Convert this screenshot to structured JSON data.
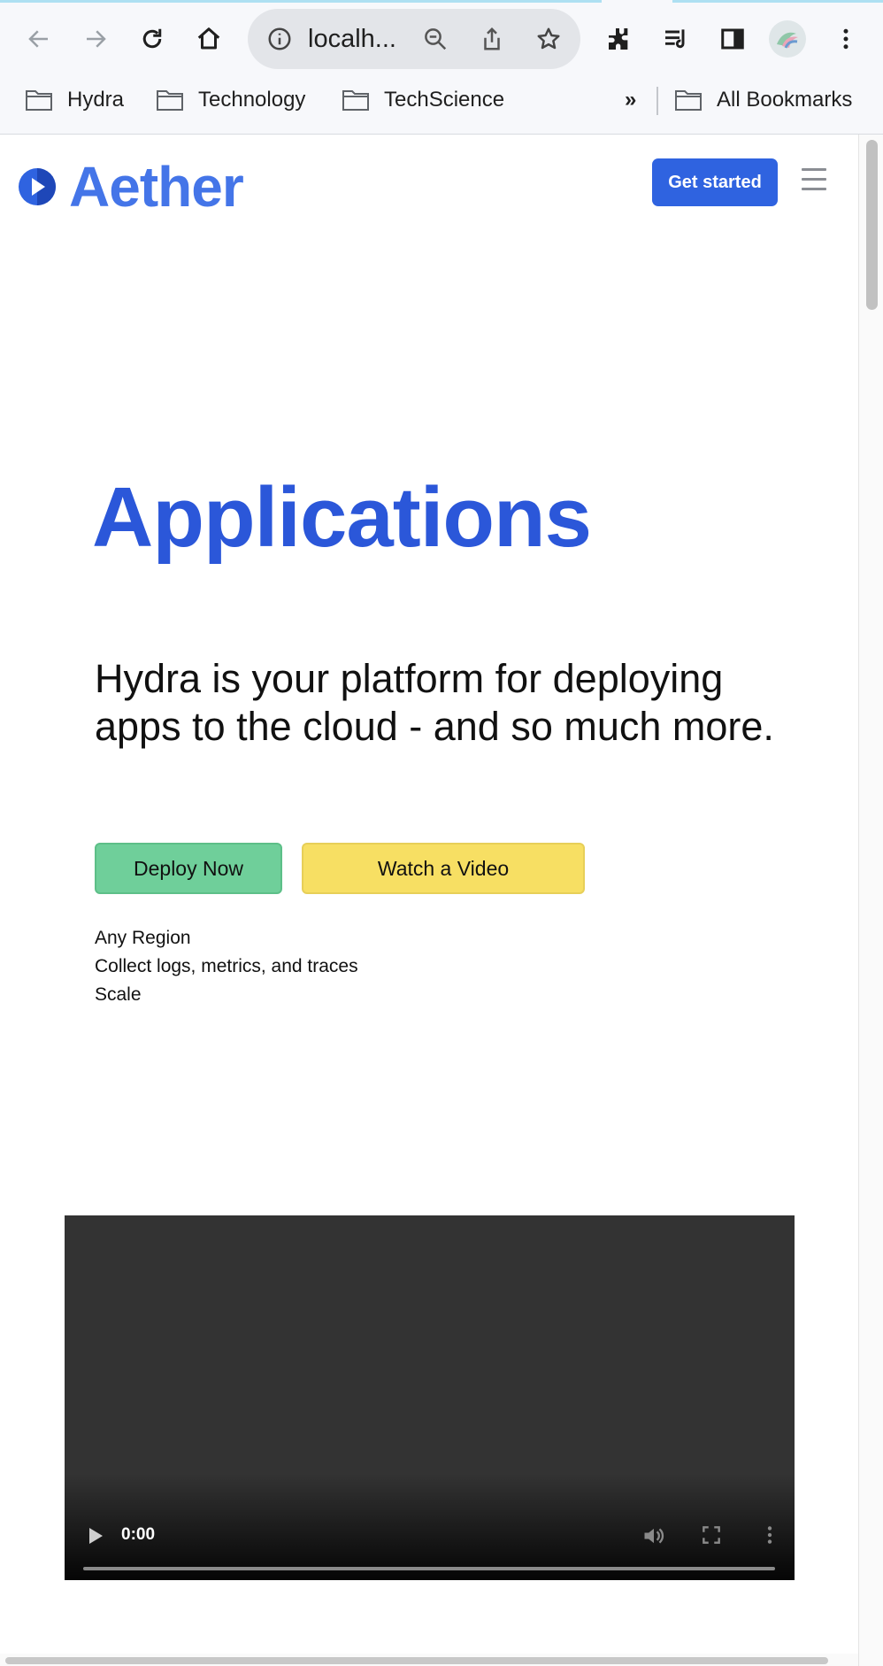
{
  "browser": {
    "url_display": "localh...",
    "bookmarks": [
      {
        "label": "Hydra",
        "icon": "folder-icon"
      },
      {
        "label": "Technology",
        "icon": "folder-icon"
      },
      {
        "label": "TechScience",
        "icon": "folder-icon"
      }
    ],
    "overflow_label": "»",
    "all_bookmarks_label": "All Bookmarks"
  },
  "site": {
    "brand": "Aether",
    "cta_label": "Get started"
  },
  "hero": {
    "title": "Applications",
    "subtitle": "Hydra is your platform for deploying apps to the cloud - and so much more.",
    "primary_button": "Deploy Now",
    "secondary_button": "Watch a Video",
    "features": [
      "Any Region",
      "Collect logs, metrics, and traces",
      "Scale"
    ]
  },
  "video": {
    "time": "0:00",
    "progress": 0
  },
  "colors": {
    "brand": "#4475e8",
    "title": "#2b57d9",
    "cta": "#2f63e0",
    "deploy": "#6fcf9a",
    "video_button": "#f7df63"
  }
}
